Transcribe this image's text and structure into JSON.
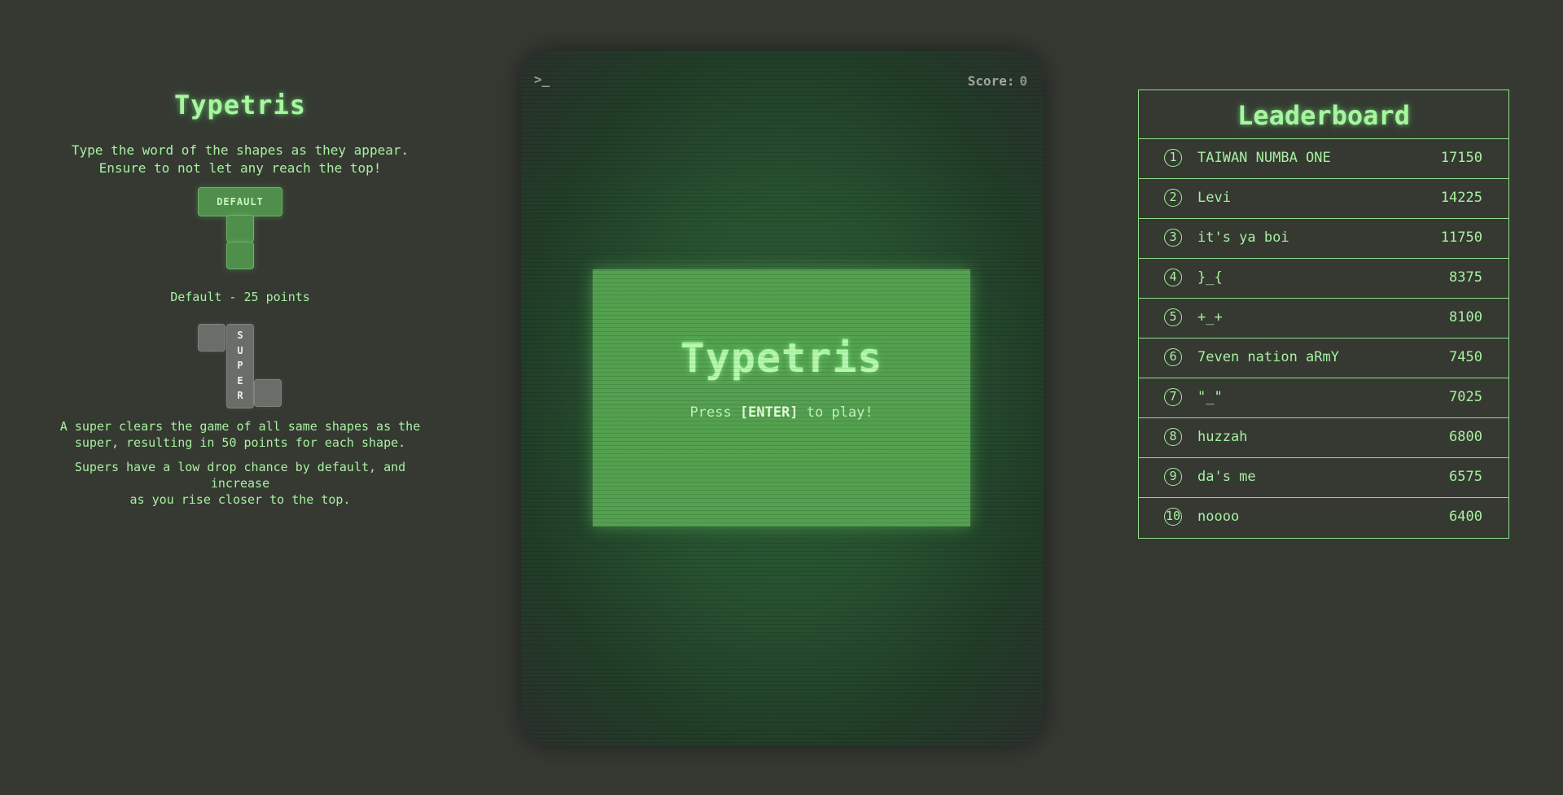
{
  "info": {
    "title": "Typetris",
    "intro_line1": "Type the word of the shapes as they appear.",
    "intro_line2": "Ensure to not let any reach the top!",
    "default_shape_label": "DEFAULT",
    "default_caption": "Default - 25 points",
    "super_letters": [
      "S",
      "U",
      "P",
      "E",
      "R"
    ],
    "super_desc_line1": "A super clears the game of all same shapes as the",
    "super_desc_line2": "super, resulting in 50 points for each shape.",
    "super_note_line1": "Supers have a low drop chance by default, and increase",
    "super_note_line2": "as you rise closer to the top."
  },
  "game": {
    "prompt": ">_",
    "score_label": "Score:",
    "score_value": "0",
    "start_title": "Typetris",
    "hint_before": "Press ",
    "hint_key": "[ENTER]",
    "hint_after": " to play!"
  },
  "leaderboard": {
    "title": "Leaderboard",
    "entries": [
      {
        "rank": "1",
        "name": "TAIWAN NUMBA ONE",
        "score": "17150"
      },
      {
        "rank": "2",
        "name": "Levi",
        "score": "14225"
      },
      {
        "rank": "3",
        "name": "it's ya boi",
        "score": "11750"
      },
      {
        "rank": "4",
        "name": "}_{",
        "score": "8375"
      },
      {
        "rank": "5",
        "name": "+_+",
        "score": "8100"
      },
      {
        "rank": "6",
        "name": "7even nation aRmY",
        "score": "7450"
      },
      {
        "rank": "7",
        "name": "\"_\"",
        "score": "7025"
      },
      {
        "rank": "8",
        "name": "huzzah",
        "score": "6800"
      },
      {
        "rank": "9",
        "name": "da's me",
        "score": "6575"
      },
      {
        "rank": "10",
        "name": "noooo",
        "score": "6400"
      }
    ]
  },
  "colors": {
    "background": "#353932",
    "accent_green": "#a8f0a0",
    "block_green": "#4f8f4b",
    "block_gray": "#6b6d69",
    "start_box": "#53a04f"
  }
}
